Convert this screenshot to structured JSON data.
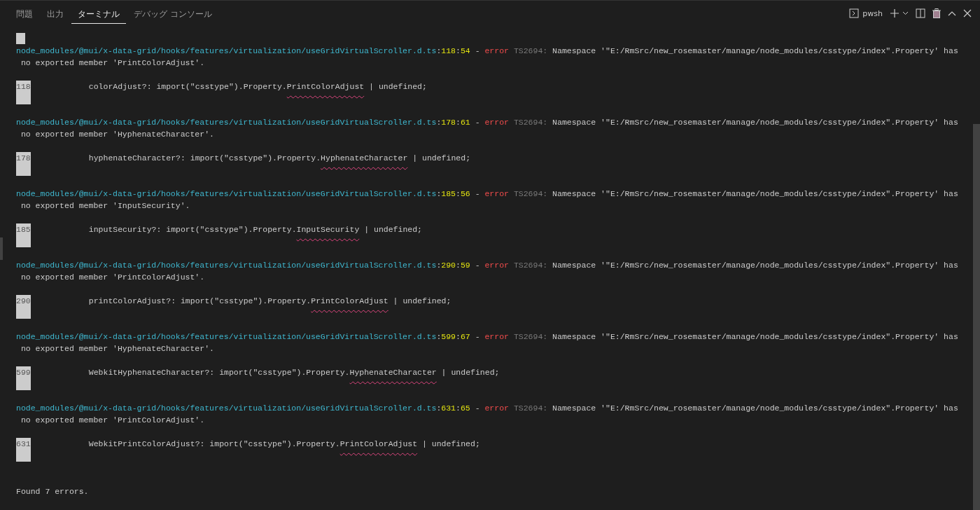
{
  "tabs": [
    {
      "label": "問題",
      "selected": false
    },
    {
      "label": "出力",
      "selected": false
    },
    {
      "label": "ターミナル",
      "selected": true
    },
    {
      "label": "デバッグ コンソール",
      "selected": false
    }
  ],
  "toolbar": {
    "shell": "pwsh"
  },
  "errors": [
    {
      "location": [
        {
          "kind": "path",
          "text": "node_modules/@mui/x-data-grid/hooks/features/virtualization/useGridVirtualScroller.d.ts"
        },
        {
          "kind": "plain",
          "text": ":"
        },
        {
          "kind": "number",
          "text": "118"
        },
        {
          "kind": "plain",
          "text": ":"
        },
        {
          "kind": "number",
          "text": "54"
        },
        {
          "kind": "plain",
          "text": " - "
        },
        {
          "kind": "error",
          "text": "error"
        },
        {
          "kind": "code",
          "text": " TS2694:"
        },
        {
          "kind": "plain",
          "text": " Namespace '\"E:/RmSrc/new_rosemaster/manage/node_modules/csstype/index\".Property' has"
        }
      ],
      "continuation": " no exported member 'PrintColorAdjust'.",
      "source": {
        "number": "118",
        "before": "            colorAdjust?: import(\"csstype\").Property.",
        "marked": "PrintColorAdjust",
        "after": " | undefined;"
      }
    },
    {
      "location": [
        {
          "kind": "path",
          "text": "node_modules/@mui/x-data-grid/hooks/features/virtualization/useGridVirtualScroller.d.ts"
        },
        {
          "kind": "plain",
          "text": ":"
        },
        {
          "kind": "number",
          "text": "178"
        },
        {
          "kind": "plain",
          "text": ":"
        },
        {
          "kind": "number",
          "text": "61"
        },
        {
          "kind": "plain",
          "text": " - "
        },
        {
          "kind": "error",
          "text": "error"
        },
        {
          "kind": "code",
          "text": " TS2694:"
        },
        {
          "kind": "plain",
          "text": " Namespace '\"E:/RmSrc/new_rosemaster/manage/node_modules/csstype/index\".Property' has"
        }
      ],
      "continuation": " no exported member 'HyphenateCharacter'.",
      "source": {
        "number": "178",
        "before": "            hyphenateCharacter?: import(\"csstype\").Property.",
        "marked": "HyphenateCharacter",
        "after": " | undefined;"
      }
    },
    {
      "location": [
        {
          "kind": "path",
          "text": "node_modules/@mui/x-data-grid/hooks/features/virtualization/useGridVirtualScroller.d.ts"
        },
        {
          "kind": "plain",
          "text": ":"
        },
        {
          "kind": "number",
          "text": "185"
        },
        {
          "kind": "plain",
          "text": ":"
        },
        {
          "kind": "number",
          "text": "56"
        },
        {
          "kind": "plain",
          "text": " - "
        },
        {
          "kind": "error",
          "text": "error"
        },
        {
          "kind": "code",
          "text": " TS2694:"
        },
        {
          "kind": "plain",
          "text": " Namespace '\"E:/RmSrc/new_rosemaster/manage/node_modules/csstype/index\".Property' has"
        }
      ],
      "continuation": " no exported member 'InputSecurity'.",
      "source": {
        "number": "185",
        "before": "            inputSecurity?: import(\"csstype\").Property.",
        "marked": "InputSecurity",
        "after": " | undefined;"
      }
    },
    {
      "location": [
        {
          "kind": "path",
          "text": "node_modules/@mui/x-data-grid/hooks/features/virtualization/useGridVirtualScroller.d.ts"
        },
        {
          "kind": "plain",
          "text": ":"
        },
        {
          "kind": "number",
          "text": "290"
        },
        {
          "kind": "plain",
          "text": ":"
        },
        {
          "kind": "number",
          "text": "59"
        },
        {
          "kind": "plain",
          "text": " - "
        },
        {
          "kind": "error",
          "text": "error"
        },
        {
          "kind": "code",
          "text": " TS2694:"
        },
        {
          "kind": "plain",
          "text": " Namespace '\"E:/RmSrc/new_rosemaster/manage/node_modules/csstype/index\".Property' has"
        }
      ],
      "continuation": " no exported member 'PrintColorAdjust'.",
      "source": {
        "number": "290",
        "before": "            printColorAdjust?: import(\"csstype\").Property.",
        "marked": "PrintColorAdjust",
        "after": " | undefined;"
      }
    },
    {
      "location": [
        {
          "kind": "path",
          "text": "node_modules/@mui/x-data-grid/hooks/features/virtualization/useGridVirtualScroller.d.ts"
        },
        {
          "kind": "plain",
          "text": ":"
        },
        {
          "kind": "number",
          "text": "599"
        },
        {
          "kind": "plain",
          "text": ":"
        },
        {
          "kind": "number",
          "text": "67"
        },
        {
          "kind": "plain",
          "text": " - "
        },
        {
          "kind": "error",
          "text": "error"
        },
        {
          "kind": "code",
          "text": " TS2694:"
        },
        {
          "kind": "plain",
          "text": " Namespace '\"E:/RmSrc/new_rosemaster/manage/node_modules/csstype/index\".Property' has"
        }
      ],
      "continuation": " no exported member 'HyphenateCharacter'.",
      "source": {
        "number": "599",
        "before": "            WebkitHyphenateCharacter?: import(\"csstype\").Property.",
        "marked": "HyphenateCharacter",
        "after": " | undefined;"
      }
    },
    {
      "location": [
        {
          "kind": "path",
          "text": "node_modules/@mui/x-data-grid/hooks/features/virtualization/useGridVirtualScroller.d.ts"
        },
        {
          "kind": "plain",
          "text": ":"
        },
        {
          "kind": "number",
          "text": "631"
        },
        {
          "kind": "plain",
          "text": ":"
        },
        {
          "kind": "number",
          "text": "65"
        },
        {
          "kind": "plain",
          "text": " - "
        },
        {
          "kind": "error",
          "text": "error"
        },
        {
          "kind": "code",
          "text": " TS2694:"
        },
        {
          "kind": "plain",
          "text": " Namespace '\"E:/RmSrc/new_rosemaster/manage/node_modules/csstype/index\".Property' has"
        }
      ],
      "continuation": " no exported member 'PrintColorAdjust'.",
      "source": {
        "number": "631",
        "before": "            WebkitPrintColorAdjust?: import(\"csstype\").Property.",
        "marked": "PrintColorAdjust",
        "after": " | undefined;"
      }
    }
  ],
  "summary": "Found 7 errors."
}
